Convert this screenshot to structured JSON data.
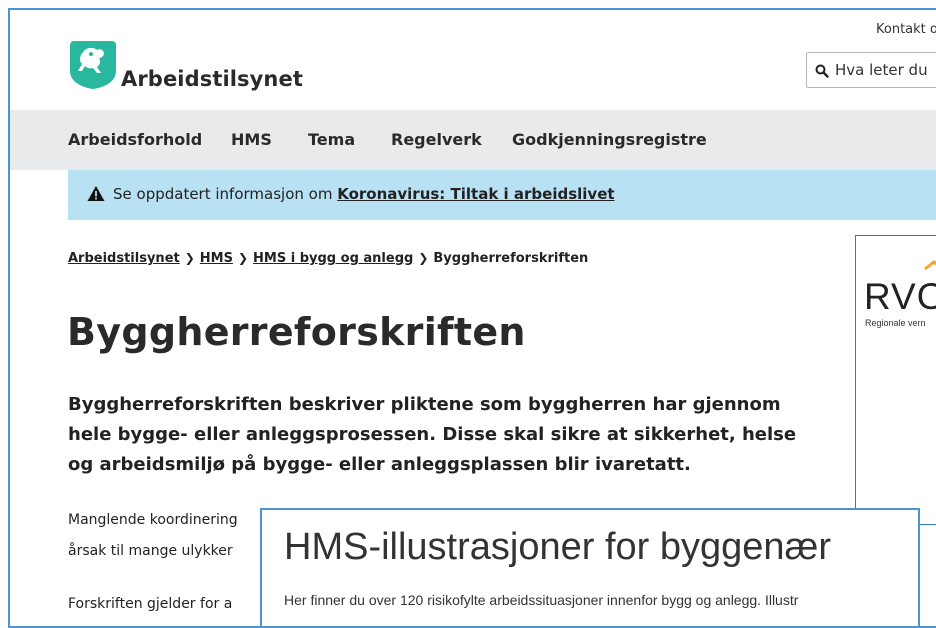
{
  "header": {
    "logo_text": "Arbeidstilsynet",
    "util_link": "Kontakt o",
    "search_placeholder": "Hva leter du"
  },
  "nav": {
    "items": [
      "Arbeidsforhold",
      "HMS",
      "Tema",
      "Regelverk",
      "Godkjenningsregistre"
    ]
  },
  "alert": {
    "text": "Se oppdatert informasjon om ",
    "link": "Koronavirus: Tiltak i arbeidslivet"
  },
  "breadcrumb": {
    "items": [
      "Arbeidstilsynet",
      "HMS",
      "HMS i bygg og anlegg"
    ],
    "current": "Byggherreforskriften"
  },
  "main": {
    "title": "Byggherreforskriften",
    "ingress_lines": [
      "Byggherreforskriften beskriver pliktene som byggherren har gjennom",
      "hele bygge- eller anleggsprosessen. Disse skal sikre at sikkerhet, helse",
      "og arbeidsmiljø på bygge- eller anleggsplassen blir ivaretatt."
    ],
    "para_lines": [
      "Manglende koordinering",
      "årsak til mange ulykker",
      "Forskriften gjelder for a"
    ]
  },
  "ad": {
    "logo_text": "RVO",
    "subtitle": "Regionale vern"
  },
  "popup": {
    "title": "HMS-illustrasjoner for byggenær",
    "text": "Her finner du over 120 risikofylte arbeidssituasjoner innenfor bygg og anlegg. Illustr"
  },
  "colors": {
    "brand_teal": "#29b79f",
    "alert_bg": "#b9e1f4",
    "nav_bg": "#e9eaec",
    "overlay_border": "#4b93d1",
    "ad_accent": "#f0a732"
  }
}
